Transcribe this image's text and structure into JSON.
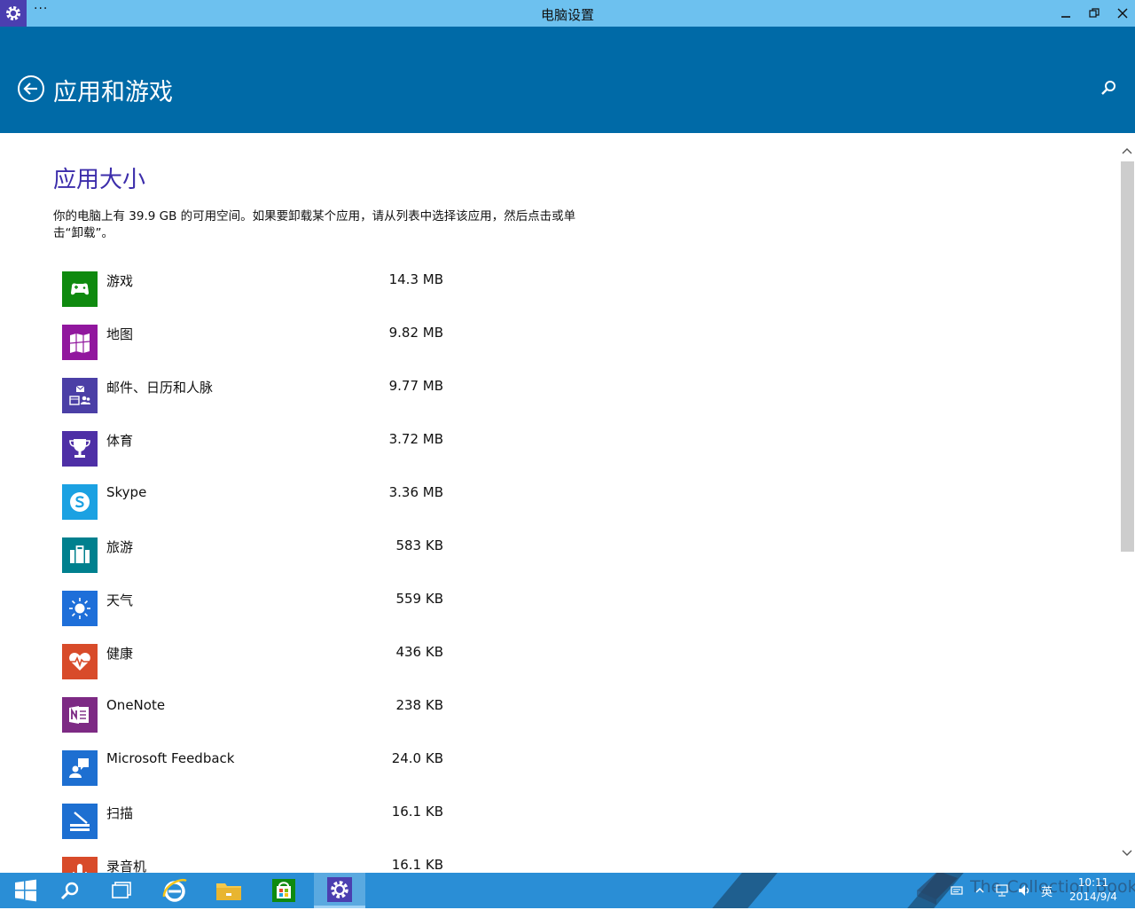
{
  "window": {
    "title": "电脑设置",
    "menu_glyph": "···",
    "minimize": "—",
    "restore": "❐",
    "close": "✕"
  },
  "header": {
    "title": "应用和游戏"
  },
  "section": {
    "title": "应用大小",
    "description": "你的电脑上有 39.9 GB 的可用空间。如果要卸载某个应用，请从列表中选择该应用，然后点击或单击“卸载”。"
  },
  "apps": [
    {
      "name": "游戏",
      "size": "14.3 MB",
      "color": "#0f8a0f",
      "icon": "game-controller-icon"
    },
    {
      "name": "地图",
      "size": "9.82 MB",
      "color": "#91179e",
      "icon": "map-icon"
    },
    {
      "name": "邮件、日历和人脉",
      "size": "9.77 MB",
      "color": "#4b3fa6",
      "icon": "mail-calendar-people-icon"
    },
    {
      "name": "体育",
      "size": "3.72 MB",
      "color": "#4e2fa6",
      "icon": "trophy-icon"
    },
    {
      "name": "Skype",
      "size": "3.36 MB",
      "color": "#1ba1e2",
      "icon": "skype-icon"
    },
    {
      "name": "旅游",
      "size": "583 KB",
      "color": "#00808e",
      "icon": "suitcase-icon"
    },
    {
      "name": "天气",
      "size": "559 KB",
      "color": "#1e6fd9",
      "icon": "sun-icon"
    },
    {
      "name": "健康",
      "size": "436 KB",
      "color": "#d84b2a",
      "icon": "heart-pulse-icon"
    },
    {
      "name": "OneNote",
      "size": "238 KB",
      "color": "#7d2a84",
      "icon": "onenote-icon"
    },
    {
      "name": "Microsoft Feedback",
      "size": "24.0 KB",
      "color": "#1d6fd1",
      "icon": "feedback-icon"
    },
    {
      "name": "扫描",
      "size": "16.1 KB",
      "color": "#1d6fd1",
      "icon": "scanner-icon"
    },
    {
      "name": "录音机",
      "size": "16.1 KB",
      "color": "#d84b2a",
      "icon": "microphone-icon"
    }
  ],
  "taskbar": {
    "items": [
      "start-icon",
      "search-icon",
      "task-view-icon",
      "internet-explorer-icon",
      "file-explorer-icon",
      "store-icon",
      "settings-icon"
    ],
    "tray_lang": "英",
    "time": "10:11",
    "date": "2014/9/4",
    "watermark": "The Collection Book"
  }
}
